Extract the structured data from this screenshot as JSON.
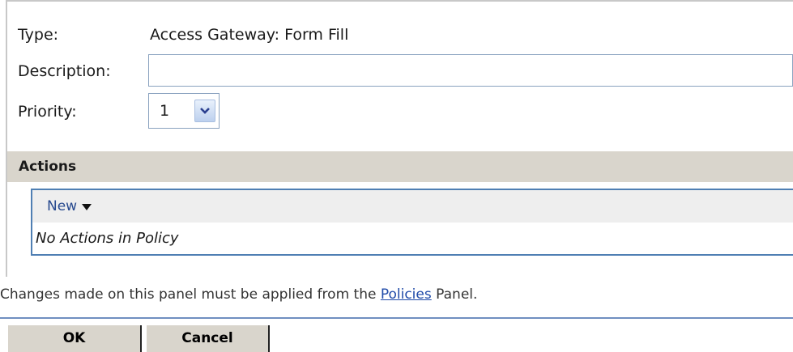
{
  "form": {
    "type_label": "Type:",
    "type_value": "Access Gateway: Form Fill",
    "description_label": "Description:",
    "description_value": "",
    "priority_label": "Priority:",
    "priority_value": "1"
  },
  "actions": {
    "header": "Actions",
    "new_label": "New",
    "empty_message": "No Actions in Policy"
  },
  "note": {
    "prefix": "Changes made on this panel must be applied from the ",
    "link": "Policies",
    "suffix": " Panel."
  },
  "buttons": {
    "ok": "OK",
    "cancel": "Cancel"
  },
  "colors": {
    "section_bg": "#d9d5cc",
    "border_blue": "#4f7fb3",
    "link_blue": "#1f4aa8"
  },
  "icons": {
    "priority_dropdown": "chevron-down-icon",
    "new_menu": "caret-down-icon"
  }
}
